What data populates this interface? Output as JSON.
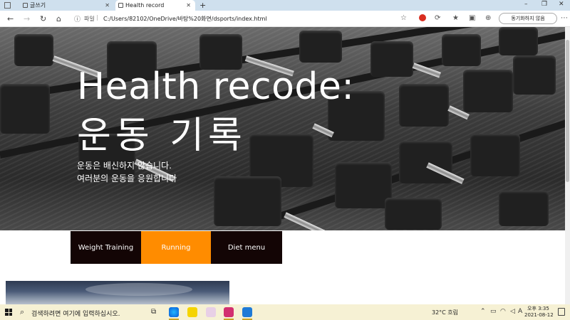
{
  "browser": {
    "tabs": [
      {
        "label": "글쓰기"
      },
      {
        "label": "Health record"
      }
    ],
    "new_tab": "+",
    "window_controls": {
      "minimize": "–",
      "maximize": "❐",
      "close": "✕"
    },
    "address": {
      "protocol_label": "파일",
      "separator": "|",
      "url": "C:/Users/82102/OneDrive/바탕%20화면/dsports/index.html"
    },
    "sync_button": "동기화하지 않음"
  },
  "hero": {
    "title_line1": "Health recode:",
    "title_line2": "운동 기록",
    "subtitle_line1": "운동은 배신하지 않습니다.",
    "subtitle_line2": "여러분의 운동을 응원합니다"
  },
  "menu": {
    "items": [
      {
        "label": "Weight Training"
      },
      {
        "label": "Running"
      },
      {
        "label": "Diet menu"
      }
    ],
    "active_color": "#ff8c00",
    "base_color": "#130505"
  },
  "taskbar": {
    "search_placeholder": "검색하려면 여기에 입력하십시오.",
    "weather": "32°C  흐림",
    "time": "오후 3:35",
    "date": "2021-08-12"
  },
  "icons": {
    "back": "back-arrow-icon",
    "forward": "forward-arrow-icon",
    "refresh": "refresh-icon",
    "home": "home-icon"
  }
}
